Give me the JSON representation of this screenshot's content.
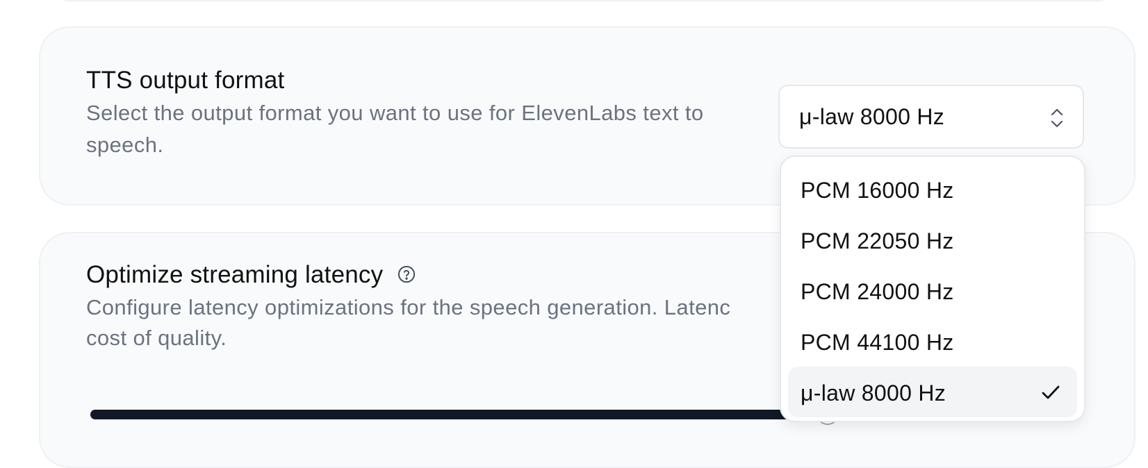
{
  "tts_card": {
    "title": "TTS output format",
    "description": "Select the output format you want to use for ElevenLabs text to speech."
  },
  "format_select": {
    "value": "μ-law 8000 Hz",
    "icon": "chevron-up-down-icon"
  },
  "format_options": [
    {
      "label": "PCM 16000 Hz",
      "selected": false
    },
    {
      "label": "PCM 22050 Hz",
      "selected": false
    },
    {
      "label": "PCM 24000 Hz",
      "selected": false
    },
    {
      "label": "PCM 44100 Hz",
      "selected": false
    },
    {
      "label": "μ-law 8000 Hz",
      "selected": true
    }
  ],
  "latency_card": {
    "title": "Optimize streaming latency",
    "description_line1": "Configure latency optimizations for the speech generation. Latenc",
    "description_line2": "cost of quality.",
    "help_icon": "help-circle-icon"
  },
  "colors": {
    "card_bg": "#f9fafb",
    "card_border": "#eef0f3",
    "muted_text": "#6b7280",
    "slider_track": "#111827",
    "selected_option_bg": "#f3f4f6"
  }
}
